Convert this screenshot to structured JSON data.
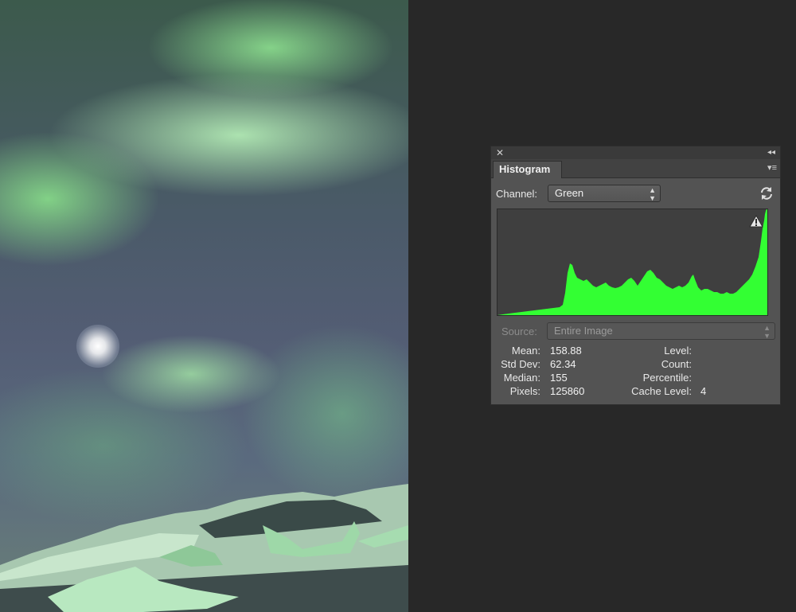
{
  "photo": {
    "description_icon": "aurora-photo"
  },
  "panel": {
    "close_icon": "close-icon",
    "collapse_glyph": "◂◂",
    "tab_label": "Histogram",
    "menu_glyph": "▾≡",
    "channel_label": "Channel:",
    "channel_value": "Green",
    "refresh_icon": "refresh-icon",
    "warning_icon": "warning-icon",
    "source_label": "Source:",
    "source_value": "Entire Image",
    "stats": {
      "mean_label": "Mean:",
      "mean_value": "158.88",
      "stddev_label": "Std Dev:",
      "stddev_value": "62.34",
      "median_label": "Median:",
      "median_value": "155",
      "pixels_label": "Pixels:",
      "pixels_value": "125860",
      "level_label": "Level:",
      "level_value": "",
      "count_label": "Count:",
      "count_value": "",
      "percentile_label": "Percentile:",
      "percentile_value": "",
      "cache_label": "Cache Level:",
      "cache_value": "4"
    },
    "histogram_color": "#33ff33"
  }
}
